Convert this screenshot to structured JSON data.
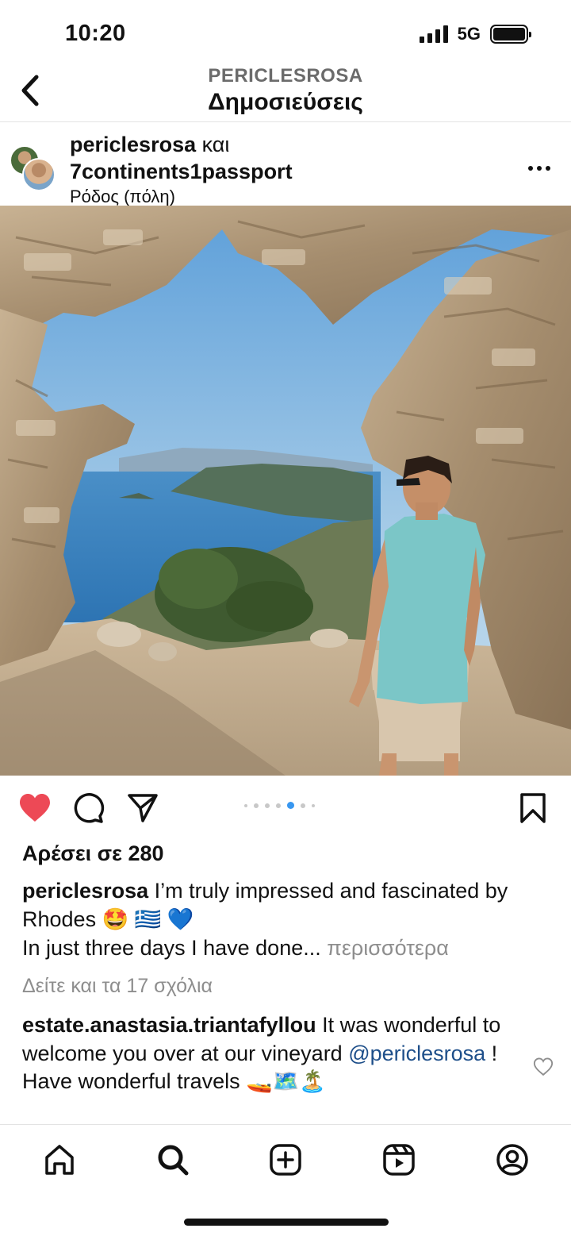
{
  "status_bar": {
    "time": "10:20",
    "network": "5G"
  },
  "header": {
    "subtitle": "PERICLESROSA",
    "title": "Δημοσιεύσεις"
  },
  "post": {
    "user_primary": "periclesrosa",
    "user_joiner": " και",
    "user_secondary": "7continents1passport",
    "location": "Ρόδος (πόλη)",
    "carousel": {
      "total": 7,
      "active_index": 4
    },
    "likes": "Αρέσει σε 280",
    "caption": {
      "user": "periclesrosa",
      "text_line1": " I’m truly impressed and fascinated by Rhodes 🤩 🇬🇷 💙",
      "text_line2": "In just three days I have done...",
      "more": "περισσότερα"
    },
    "view_comments": "Δείτε και τα 17 σχόλια",
    "comment": {
      "user": "estate.anastasia.triantafyllou",
      "text_before": " It was wonderful to welcome you over at our vineyard ",
      "mention": "@periclesrosa",
      "text_after": " ! Have wonderful travels 🚤🗺️🏝️"
    }
  },
  "colors": {
    "like_red": "#ed4956",
    "accent_blue": "#3897f0",
    "muted_gray": "#8e8e8e",
    "mention_blue": "#1e4f8a"
  },
  "icons": [
    "back-chevron-icon",
    "more-icon",
    "heart-icon",
    "comment-icon",
    "share-icon",
    "bookmark-icon",
    "home-icon",
    "search-icon",
    "create-icon",
    "reels-icon",
    "profile-icon"
  ]
}
